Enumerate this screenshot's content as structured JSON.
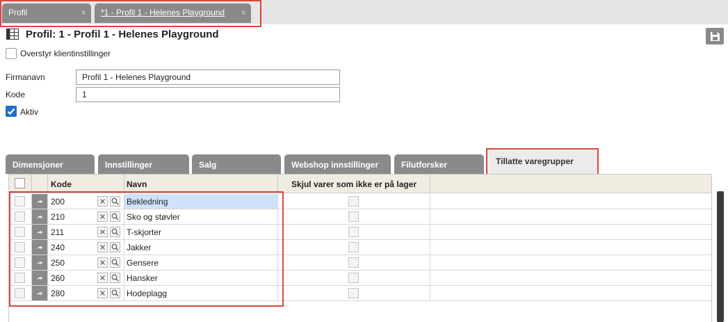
{
  "doc_tabs": [
    {
      "label": "Profil",
      "close": "x"
    },
    {
      "label": "*1 - Profil 1 - Helenes Playground",
      "close": "x"
    }
  ],
  "page_title": "Profil: 1 - Profil 1 - Helenes Playground",
  "override_label": "Overstyr klientinstillinger",
  "form": {
    "firmanavn_label": "Firmanavn",
    "firmanavn_value": "Profil 1 - Helenes Playground",
    "kode_label": "Kode",
    "kode_value": "1",
    "aktiv_label": "Aktiv"
  },
  "section_tabs": [
    {
      "label": "Dimensjoner"
    },
    {
      "label": "Innstillinger"
    },
    {
      "label": "Salg"
    },
    {
      "label": "Webshop innstillinger"
    },
    {
      "label": "Filutforsker"
    },
    {
      "label": "Tillatte varegrupper"
    }
  ],
  "grid": {
    "headers": {
      "kode": "Kode",
      "navn": "Navn",
      "skjul": "Skjul varer som ikke er på lager"
    },
    "rows": [
      {
        "kode": "200",
        "navn": "Bekledning",
        "selected": true
      },
      {
        "kode": "210",
        "navn": "Sko og støvler"
      },
      {
        "kode": "211",
        "navn": "T-skjorter"
      },
      {
        "kode": "240",
        "navn": "Jakker"
      },
      {
        "kode": "250",
        "navn": "Gensere"
      },
      {
        "kode": "260",
        "navn": "Hansker"
      },
      {
        "kode": "280",
        "navn": "Hodeplagg"
      }
    ]
  },
  "colors": {
    "tab_gray": "#8a8a8a",
    "header_bg": "#f0ece1",
    "highlight_red": "#d9463f",
    "selected_cell": "#cfe2fb",
    "check_blue": "#1f6fc9"
  }
}
